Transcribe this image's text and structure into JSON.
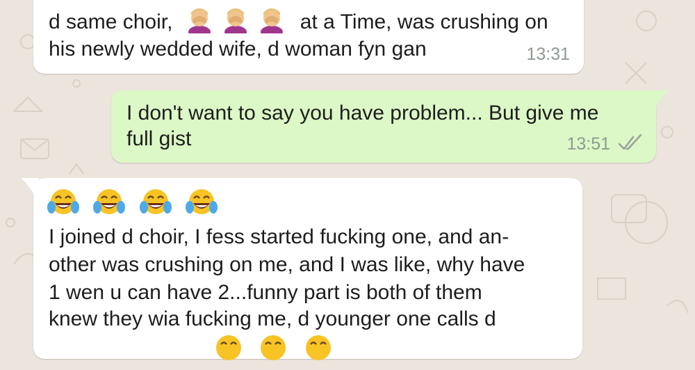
{
  "chat": {
    "messages": [
      {
        "type": "incoming",
        "line1_pre": "d same choir,",
        "line1_post": "at a Time, was crushing on",
        "line2": "his newly wedded wife, d woman fyn gan",
        "time": "13:31",
        "emoji_icons": [
          "facepalm-woman-emoji",
          "facepalm-woman-emoji",
          "facepalm-woman-emoji"
        ]
      },
      {
        "type": "outgoing",
        "line1": "I don't want to say you have problem... But give me",
        "line2": "full gist",
        "time": "13:51",
        "status_icon": "double-check-icon"
      },
      {
        "type": "incoming",
        "emoji_icons": [
          "tears-of-joy-emoji",
          "tears-of-joy-emoji",
          "tears-of-joy-emoji",
          "tears-of-joy-emoji"
        ],
        "lines": [
          "I joined d choir, I fess started fucking one, and an-",
          "other was crushing on me, and I was like, why have",
          "1 wen u can have 2...funny part is both of them",
          "knew they wia fucking me, d younger one calls d"
        ]
      }
    ]
  },
  "colors": {
    "wallpaper": "#ece5dd",
    "incoming_bubble": "#ffffff",
    "outgoing_bubble": "#dcf8c6",
    "timestamp": "#8e9a92",
    "read_ticks": "#9aa39d"
  }
}
